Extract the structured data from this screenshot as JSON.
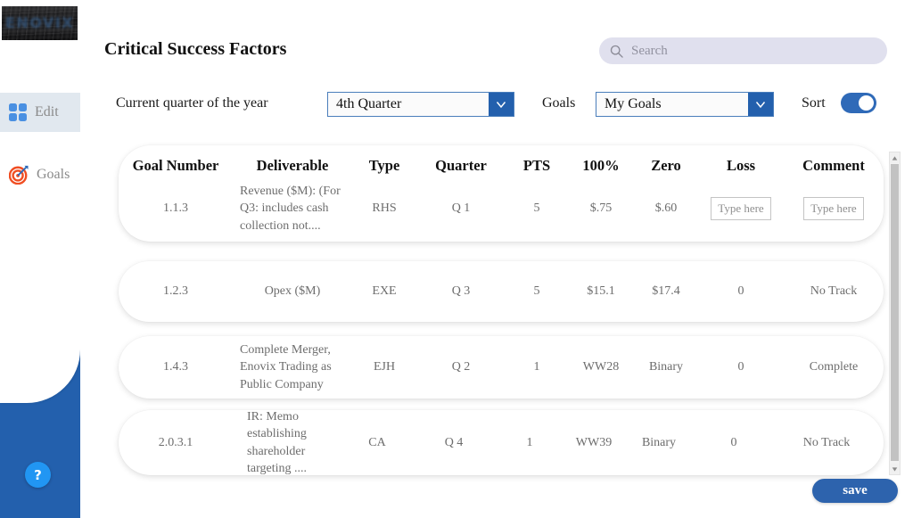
{
  "sidebar": {
    "logo_text": "ENOVIX",
    "items": [
      {
        "label": "Edit",
        "icon": "grid-icon",
        "active": true
      },
      {
        "label": "Goals",
        "icon": "target-icon",
        "active": false
      }
    ],
    "help_label": "?"
  },
  "header": {
    "title": "Critical Success Factors",
    "search_placeholder": "Search",
    "search_value": ""
  },
  "filters": {
    "quarter_label": "Current quarter of the year",
    "quarter_value": "4th Quarter",
    "goals_label": "Goals",
    "goals_value": "My Goals",
    "sort_label": "Sort",
    "sort_on": true
  },
  "table": {
    "columns": [
      "Goal Number",
      "Deliverable",
      "Type",
      "Quarter",
      "PTS",
      "100%",
      "Zero",
      "Loss",
      "Comment"
    ],
    "rows": [
      {
        "goal_number": "1.1.3",
        "deliverable": "Revenue ($M): (For Q3: includes cash collection not....",
        "type": "RHS",
        "quarter": "Q 1",
        "pts": "5",
        "hundred": "$.75",
        "zero": "$.60",
        "loss": "Type here",
        "comment": "Type here",
        "loss_is_input": true,
        "comment_is_input": true
      },
      {
        "goal_number": "1.2.3",
        "deliverable": "Opex ($M)",
        "type": "EXE",
        "quarter": "Q 3",
        "pts": "5",
        "hundred": "$15.1",
        "zero": "$17.4",
        "loss": "0",
        "comment": "No Track",
        "loss_is_input": false,
        "comment_is_input": false
      },
      {
        "goal_number": "1.4.3",
        "deliverable": "Complete Merger, Enovix Trading as Public Company",
        "type": "EJH",
        "quarter": "Q 2",
        "pts": "1",
        "hundred": "WW28",
        "zero": "Binary",
        "loss": "0",
        "comment": "Complete",
        "loss_is_input": false,
        "comment_is_input": false
      },
      {
        "goal_number": "2.0.3.1",
        "deliverable": "IR: Memo establishing shareholder targeting ....",
        "type": "CA",
        "quarter": "Q 4",
        "pts": "1",
        "hundred": "WW39",
        "zero": "Binary",
        "loss": "0",
        "comment": "No Track",
        "loss_is_input": false,
        "comment_is_input": false
      }
    ]
  },
  "footer": {
    "save_label": "save"
  },
  "colors": {
    "brand_blue": "#2360ad",
    "accent_blue": "#4a90e2",
    "search_bg": "#e0e0ee",
    "target_orange": "#f04e23"
  }
}
